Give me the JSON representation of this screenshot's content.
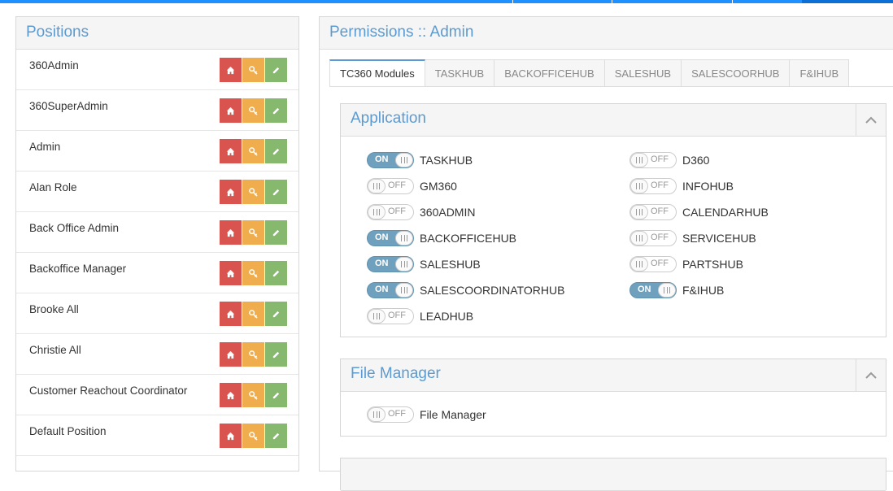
{
  "positions": {
    "title": "Positions",
    "items": [
      "360Admin",
      "360SuperAdmin",
      "Admin",
      "Alan Role",
      "Back Office Admin",
      "Backoffice Manager",
      "Brooke All",
      "Christie All",
      "Customer Reachout Coordinator",
      "Default Position"
    ],
    "actions": [
      "home-icon",
      "key-icon",
      "pencil-icon"
    ]
  },
  "permissions": {
    "title": "Permissions :: Admin",
    "tabs": [
      "TC360 Modules",
      "TASKHUB",
      "BACKOFFICEHUB",
      "SALESHUB",
      "SALESCOORHUB",
      "F&IHUB"
    ],
    "active_tab": "TC360 Modules",
    "on_text": "ON",
    "off_text": "OFF",
    "application": {
      "title": "Application",
      "left": [
        {
          "label": "TASKHUB",
          "state": "on"
        },
        {
          "label": "GM360",
          "state": "off"
        },
        {
          "label": "360ADMIN",
          "state": "off"
        },
        {
          "label": "BACKOFFICEHUB",
          "state": "on"
        },
        {
          "label": "SALESHUB",
          "state": "on"
        },
        {
          "label": "SALESCOORDINATORHUB",
          "state": "on"
        },
        {
          "label": "LEADHUB",
          "state": "off"
        }
      ],
      "right": [
        {
          "label": "D360",
          "state": "off"
        },
        {
          "label": "INFOHUB",
          "state": "off"
        },
        {
          "label": "CALENDARHUB",
          "state": "off"
        },
        {
          "label": "SERVICEHUB",
          "state": "off"
        },
        {
          "label": "PARTSHUB",
          "state": "off"
        },
        {
          "label": "F&IHUB",
          "state": "on"
        }
      ]
    },
    "file_manager": {
      "title": "File Manager",
      "items": [
        {
          "label": "File Manager",
          "state": "off"
        }
      ]
    }
  },
  "colors": {
    "accent": "#5b9bd1",
    "toggle_on": "#6fa1bf",
    "home_button": "#d9534f",
    "key_button": "#f0ad4e",
    "edit_button": "#86b96e"
  }
}
